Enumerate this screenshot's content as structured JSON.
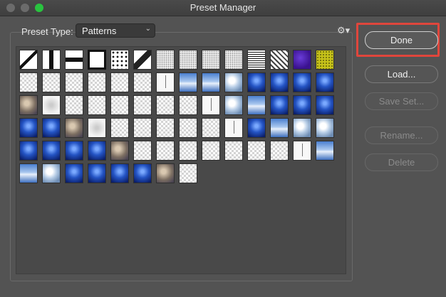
{
  "window": {
    "title": "Preset Manager",
    "traffic_lights": [
      "close-button",
      "minimize-button",
      "zoom-button"
    ]
  },
  "preset_type": {
    "label": "Preset Type:",
    "selected": "Patterns"
  },
  "toolbar": {
    "settings_icon": "gear-icon"
  },
  "buttons": {
    "done": "Done",
    "load": "Load...",
    "save_set": "Save Set...",
    "rename": "Rename...",
    "delete": "Delete"
  },
  "colors": {
    "window_bg": "#535353",
    "highlight": "#e0463c",
    "zoom_green": "#29c33f"
  },
  "patterns": [
    [
      "diag",
      "bar",
      "hbar",
      "frame",
      "dots",
      "diag2",
      "noise",
      "noise",
      "noise",
      "noise",
      "squares",
      "marble",
      "purple",
      "yellow"
    ],
    [
      "trans",
      "trans",
      "trans",
      "trans",
      "trans",
      "trans",
      "line",
      "sky",
      "sky",
      "cloud",
      "water",
      "water",
      "water",
      "water"
    ],
    [
      "rock",
      "fade",
      "trans",
      "trans",
      "trans",
      "trans",
      "trans",
      "trans",
      "line",
      "cloud",
      "sky",
      "water",
      "water",
      "water"
    ],
    [
      "water",
      "water",
      "rock",
      "fade",
      "trans",
      "trans",
      "trans",
      "trans",
      "trans",
      "line",
      "water",
      "sky",
      "cloud",
      "cloud"
    ],
    [
      "water",
      "water",
      "water",
      "water",
      "rock",
      "trans",
      "trans",
      "trans",
      "trans",
      "trans",
      "trans",
      "trans",
      "line",
      "sky"
    ],
    [
      "sky",
      "cloud",
      "water",
      "water",
      "water",
      "water",
      "rock",
      "trans"
    ]
  ]
}
